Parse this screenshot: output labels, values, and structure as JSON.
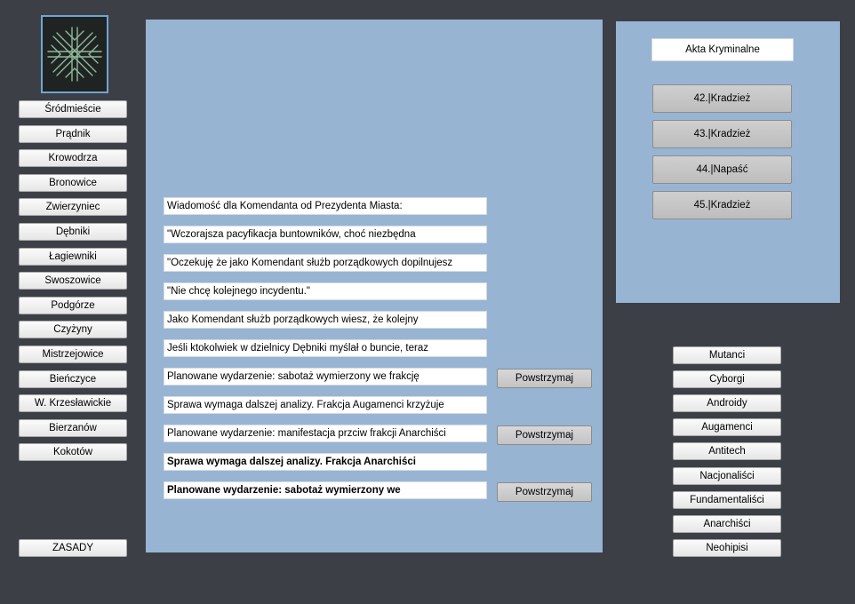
{
  "districts": [
    "Śródmieście",
    "Prądnik",
    "Krowodrza",
    "Bronowice",
    "Zwierzyniec",
    "Dębniki",
    "Łagiewniki",
    "Swoszowice",
    "Podgórze",
    "Czyżyny",
    "Mistrzejowice",
    "Bieńczyce",
    "W. Krzesławickie",
    "Bierzanów",
    "Kokotów"
  ],
  "rules_button": "ZASADY",
  "messages": [
    "Wiadomość dla Komendanta od Prezydenta Miasta:",
    "\"Wczorajsza pacyfikacja buntowników, choć niezbędna",
    "\"Oczekuję że jako Komendant służb porządkowych dopilnujesz",
    "\"Nie chcę kolejnego incydentu.\"",
    "Jako Komendant służb porządkowych wiesz, że kolejny",
    "Jeśli ktokolwiek w dzielnicy Dębniki myślał o buncie, teraz",
    "Planowane wydarzenie: sabotaż wymierzony we frakcję",
    "Sprawa wymaga dalszej analizy. Frakcja Augamenci krzyżuje",
    "Planowane wydarzenie: manifestacja przciw frakcji Anarchiści",
    "Sprawa wymaga dalszej analizy. Frakcja Anarchiści",
    "Planowane wydarzenie: sabotaż wymierzony we"
  ],
  "stop_label": "Powstrzymaj",
  "crime_panel": {
    "title": "Akta Kryminalne",
    "items": [
      "42.|Kradzież",
      "43.|Kradzież",
      "44.|Napaść",
      "45.|Kradzież"
    ]
  },
  "factions": [
    "Mutanci",
    "Cyborgi",
    "Androidy",
    "Augamenci",
    "Antitech",
    "Nacjonaliści",
    "Fundamentaliści",
    "Anarchiści",
    "Neohipisi"
  ],
  "colors": {
    "background": "#3c3f46",
    "panel": "#98b4d3",
    "logo_frame": "#6fa6d2",
    "logo_pattern": "#8fb89a"
  },
  "logo_icon": "snowflake-emblem-icon"
}
